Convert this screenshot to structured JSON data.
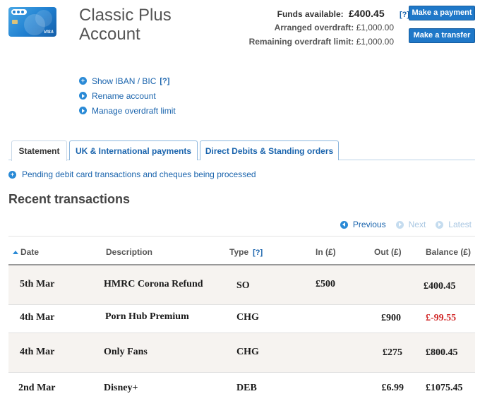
{
  "account": {
    "name": "Classic Plus Account",
    "card_label": "VISA",
    "funds_available_label": "Funds available:",
    "funds_available_value": "£400.45",
    "funds_help": "[?]",
    "arranged_overdraft_label": "Arranged overdraft:",
    "arranged_overdraft_value": "£1,000.00",
    "remaining_limit_label": "Remaining overdraft limit:",
    "remaining_limit_value": "£1,000.00"
  },
  "buttons": {
    "make_payment": "Make a payment",
    "make_transfer": "Make a transfer"
  },
  "links": {
    "show_iban": "Show IBAN / BIC",
    "iban_help": "[?]",
    "rename": "Rename account",
    "manage_overdraft": "Manage overdraft limit"
  },
  "tabs": [
    {
      "label": "Statement",
      "active": true
    },
    {
      "label": "UK & International payments",
      "active": false
    },
    {
      "label": "Direct Debits & Standing orders",
      "active": false
    }
  ],
  "pending_link": "Pending debit card transactions and cheques being processed",
  "recent": {
    "title": "Recent transactions",
    "pager": {
      "previous": "Previous",
      "next": "Next",
      "latest": "Latest"
    },
    "headers": {
      "date": "Date",
      "description": "Description",
      "type": "Type",
      "type_help": "[?]",
      "in": "In (£)",
      "out": "Out (£)",
      "balance": "Balance (£)"
    },
    "rows": [
      {
        "date": "5th Mar",
        "description": "HMRC Corona Refund",
        "type": "SO",
        "in": "£500",
        "out": "",
        "balance": "£400.45",
        "negative": false
      },
      {
        "date": "4th Mar",
        "description": "Porn Hub Premium",
        "type": "CHG",
        "in": "",
        "out": "£900",
        "balance": "£-99.55",
        "negative": true
      },
      {
        "date": "4th Mar",
        "description": "Only Fans",
        "type": "CHG",
        "in": "",
        "out": "£275",
        "balance": "£800.45",
        "negative": false
      },
      {
        "date": "2nd Mar",
        "description": "Disney+",
        "type": "DEB",
        "in": "",
        "out": "£6.99",
        "balance": "£1075.45",
        "negative": false
      }
    ]
  },
  "colors": {
    "accent": "#1f78c8",
    "link": "#1a64ad",
    "negative": "#d22a2a",
    "row_shade": "#f6f3f0"
  }
}
